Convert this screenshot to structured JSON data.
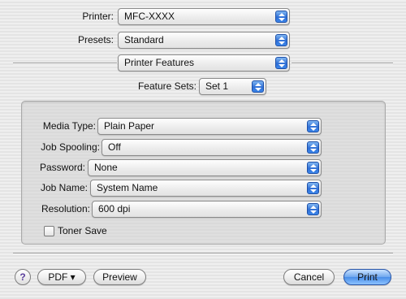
{
  "header": {
    "printer_label": "Printer:",
    "printer_value": "MFC-XXXX",
    "presets_label": "Presets:",
    "presets_value": "Standard"
  },
  "panel_selector": {
    "value": "Printer Features"
  },
  "feature_sets": {
    "label": "Feature Sets:",
    "value": "Set 1"
  },
  "options": {
    "media_type": {
      "label": "Media Type:",
      "value": "Plain Paper"
    },
    "job_spooling": {
      "label": "Job Spooling:",
      "value": "Off"
    },
    "password": {
      "label": "Password:",
      "value": "None"
    },
    "job_name": {
      "label": "Job Name:",
      "value": "System Name"
    },
    "resolution": {
      "label": "Resolution:",
      "value": "600 dpi"
    },
    "toner_save": {
      "label": "Toner Save",
      "checked": false
    }
  },
  "footer": {
    "help_glyph": "?",
    "pdf_label": "PDF ▾",
    "preview_label": "Preview",
    "cancel_label": "Cancel",
    "print_label": "Print"
  },
  "colors": {
    "accent_blue": "#3b86ea",
    "help_purple": "#5a3e9c"
  },
  "icons": {
    "popup_arrows": "updown-arrows-icon",
    "help": "help-icon"
  }
}
